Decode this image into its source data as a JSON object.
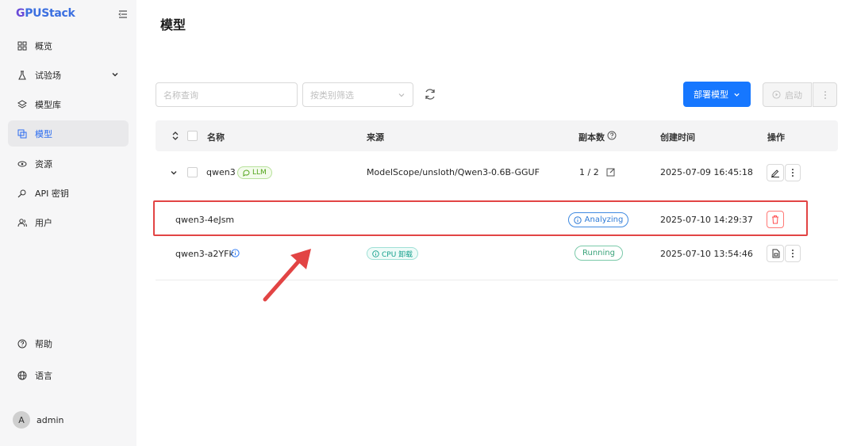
{
  "app": {
    "logo_part1": "G",
    "logo_part2": "PUStack"
  },
  "sidebar": {
    "items": [
      {
        "label": "概览",
        "icon": "dashboard-icon"
      },
      {
        "label": "试验场",
        "icon": "flask-icon"
      },
      {
        "label": "模型库",
        "icon": "layers-icon"
      },
      {
        "label": "模型",
        "icon": "model-icon",
        "active": true
      },
      {
        "label": "资源",
        "icon": "resource-icon"
      },
      {
        "label": "API 密钥",
        "icon": "key-icon"
      },
      {
        "label": "用户",
        "icon": "users-icon"
      }
    ],
    "help": "帮助",
    "language": "语言",
    "user": {
      "initial": "A",
      "name": "admin"
    }
  },
  "page": {
    "title": "模型"
  },
  "toolbar": {
    "search_placeholder": "名称查询",
    "filter_placeholder": "按类别筛选",
    "deploy_label": "部署模型",
    "start_label": "启动"
  },
  "table": {
    "columns": {
      "name": "名称",
      "source": "来源",
      "replicas": "副本数",
      "created": "创建时间",
      "actions": "操作"
    },
    "model": {
      "name": "qwen3",
      "tag": "LLM",
      "source": "ModelScope/unsloth/Qwen3-0.6B-GGUF",
      "replicas": "1 / 2",
      "created": "2025-07-09 16:45:18"
    },
    "instances": [
      {
        "name": "qwen3-4eJsm",
        "status": "Analyzing",
        "created": "2025-07-10 14:29:37"
      },
      {
        "name": "qwen3-a2YFk",
        "tag": "CPU 卸载",
        "status": "Running",
        "created": "2025-07-10 13:54:46"
      }
    ]
  },
  "colors": {
    "accent": "#1677ff",
    "active_nav": "#2b6cf0",
    "highlight": "#e24444"
  }
}
